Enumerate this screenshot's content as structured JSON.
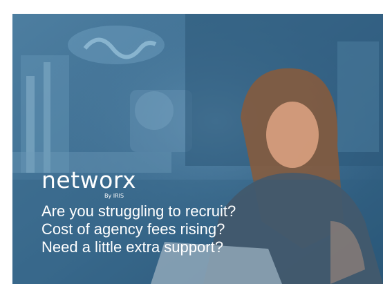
{
  "brand": {
    "name": "networx",
    "byline": "By IRIS"
  },
  "headlines": [
    "Are you struggling to recruit?",
    "Cost of agency fees rising?",
    "Need a little extra support?"
  ],
  "colors": {
    "overlay": "#3a6a8e",
    "text": "#ffffff",
    "background": "#ffffff"
  }
}
